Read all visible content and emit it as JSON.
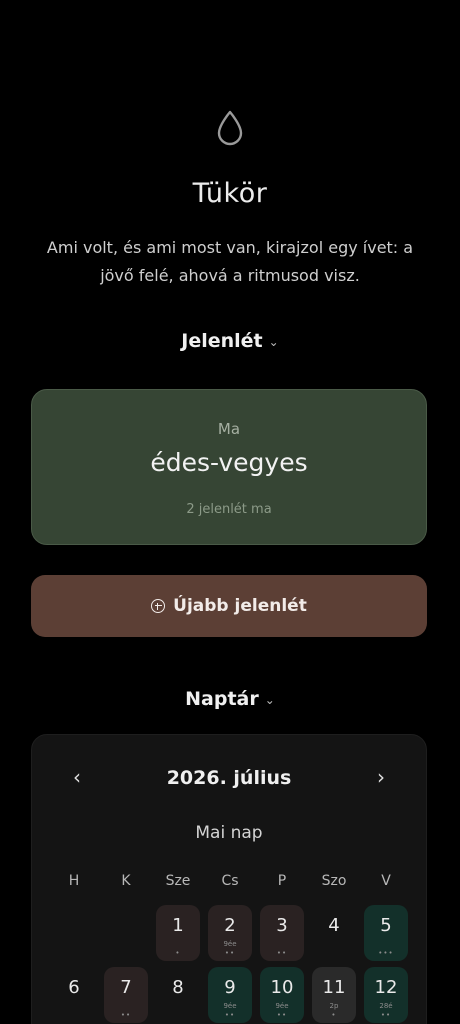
{
  "header": {
    "icon": "water-drop-icon",
    "title": "Tükör",
    "subtitle": "Ami volt, és ami most van, kirajzol egy ívet: a jövő felé, ahová a ritmusod visz."
  },
  "presence": {
    "heading": "Jelenlét",
    "chevron": "⌄",
    "card": {
      "label": "Ma",
      "value": "édes-vegyes",
      "count": "2 jelenlét ma"
    },
    "new_button": "Újabb jelenlét",
    "card_color": "#364534",
    "button_color": "#5c3f35"
  },
  "calendar": {
    "heading": "Naptár",
    "chevron": "⌄",
    "prev": "‹",
    "next": "›",
    "month_label": "2026. július",
    "today_label": "Mai nap",
    "weekdays": [
      "H",
      "K",
      "Sze",
      "Cs",
      "P",
      "Szo",
      "V"
    ],
    "weeks": [
      [
        {
          "day": "",
          "style": "empty",
          "mini": "",
          "dots": ""
        },
        {
          "day": "",
          "style": "empty",
          "mini": "",
          "dots": ""
        },
        {
          "day": "1",
          "style": "has",
          "mini": "",
          "dots": "•"
        },
        {
          "day": "2",
          "style": "has",
          "mini": "9ée",
          "dots": "••"
        },
        {
          "day": "3",
          "style": "has",
          "mini": "",
          "dots": "••"
        },
        {
          "day": "4",
          "style": "plain",
          "mini": "",
          "dots": ""
        },
        {
          "day": "5",
          "style": "green",
          "mini": "",
          "dots": "•••"
        }
      ],
      [
        {
          "day": "6",
          "style": "plain",
          "mini": "",
          "dots": ""
        },
        {
          "day": "7",
          "style": "has",
          "mini": "",
          "dots": "••"
        },
        {
          "day": "8",
          "style": "plain",
          "mini": "",
          "dots": ""
        },
        {
          "day": "9",
          "style": "green",
          "mini": "9ée",
          "dots": "••"
        },
        {
          "day": "10",
          "style": "green",
          "mini": "9ée",
          "dots": "••"
        },
        {
          "day": "11",
          "style": "hl",
          "mini": "2p",
          "dots": "•"
        },
        {
          "day": "12",
          "style": "green",
          "mini": "28é",
          "dots": "••"
        }
      ]
    ]
  }
}
